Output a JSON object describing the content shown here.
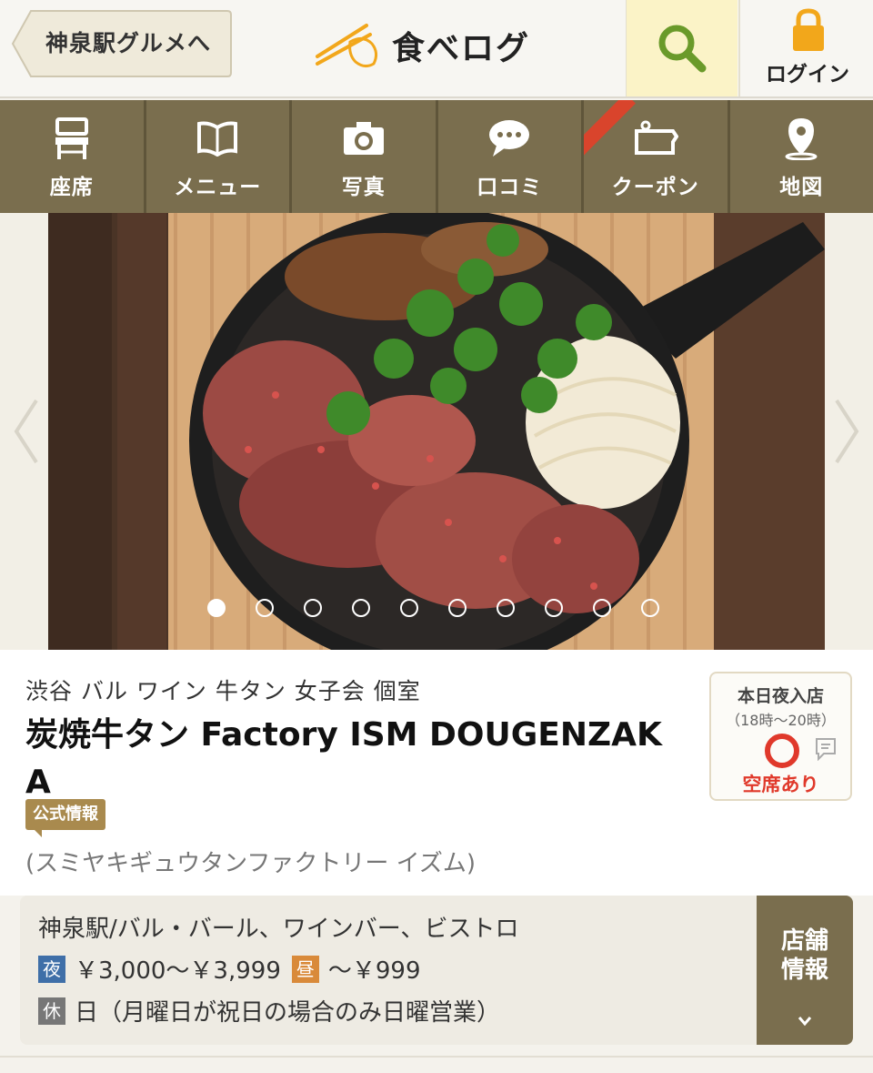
{
  "header": {
    "back_label": "神泉駅グルメへ",
    "logo_text": "食べログ",
    "login_label": "ログイン"
  },
  "nav": {
    "items": [
      {
        "label": "座席",
        "icon": "chair-icon"
      },
      {
        "label": "メニュー",
        "icon": "book-icon"
      },
      {
        "label": "写真",
        "icon": "camera-icon"
      },
      {
        "label": "口コミ",
        "icon": "speech-bubble-icon"
      },
      {
        "label": "クーポン",
        "icon": "coupon-icon"
      },
      {
        "label": "地図",
        "icon": "map-pin-icon"
      }
    ]
  },
  "gallery": {
    "total": 10,
    "active_index": 0
  },
  "restaurant": {
    "tags": "渋谷 バル ワイン 牛タン 女子会 個室",
    "name": "炭焼牛タン Factory ISM DOUGENZAKA",
    "official_badge": "公式情報",
    "kana": "(スミヤキギュウタンファクトリー イズム)"
  },
  "vacancy": {
    "title": "本日夜入店",
    "time": "（18時〜20時）",
    "status": "空席あり"
  },
  "details": {
    "genre": "神泉駅/バル・バール、ワインバー、ビストロ",
    "night_badge": "夜",
    "night_price": "￥3,000〜￥3,999",
    "lunch_badge": "昼",
    "lunch_price": "〜￥999",
    "holiday_badge": "休",
    "holiday_text": "日（月曜日が祝日の場合のみ日曜営業）",
    "shop_info_label": "店舗情報"
  },
  "colors": {
    "nav_bg": "#7a6e4e",
    "accent_red": "#e0392b",
    "search_bg": "#fbf3c7"
  }
}
